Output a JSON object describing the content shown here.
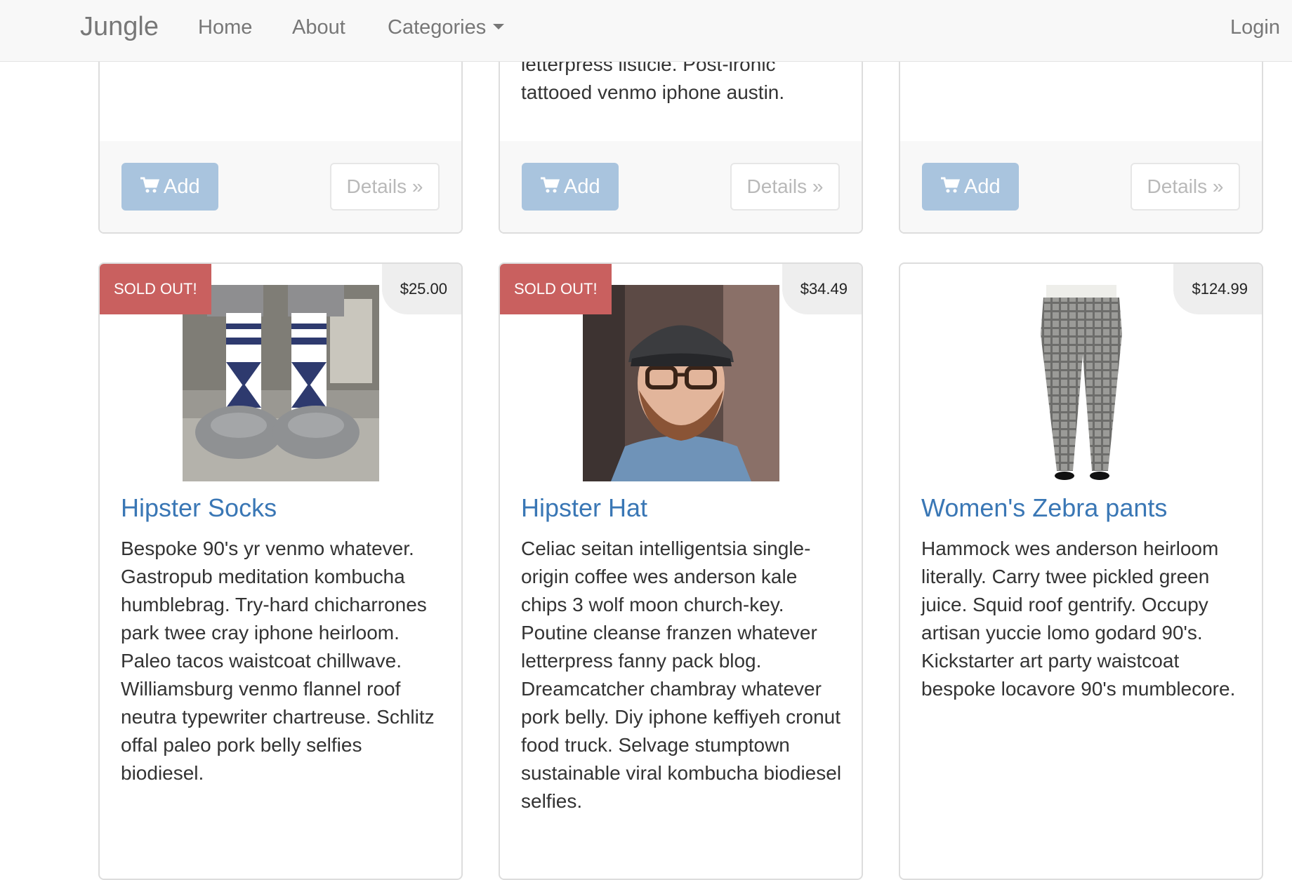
{
  "navbar": {
    "brand": "Jungle",
    "links": [
      {
        "label": "Home"
      },
      {
        "label": "About"
      },
      {
        "label": "Categories"
      }
    ],
    "login": "Login"
  },
  "top_row": [
    {
      "description_tail": "",
      "add_label": "Add",
      "details_label": "Details »"
    },
    {
      "description_tail": "letterpress listicle. Post-ironic tattooed venmo iphone austin.",
      "add_label": "Add",
      "details_label": "Details »"
    },
    {
      "description_tail": "",
      "add_label": "Add",
      "details_label": "Details »"
    }
  ],
  "products": [
    {
      "name": "Hipster Socks",
      "price": "$25.00",
      "badge": "SOLD OUT!",
      "image": "patterned-socks-photo",
      "description": "Bespoke 90's yr venmo whatever. Gastropub meditation kombucha humblebrag. Try-hard chicharrones park twee cray iphone heirloom. Paleo tacos waistcoat chillwave. Williamsburg venmo flannel roof neutra typewriter chartreuse. Schlitz offal paleo pork belly selfies biodiesel."
    },
    {
      "name": "Hipster Hat",
      "price": "$34.49",
      "badge": "SOLD OUT!",
      "image": "man-in-flat-cap-photo",
      "description": "Celiac seitan intelligentsia single-origin coffee wes anderson kale chips 3 wolf moon church-key. Poutine cleanse franzen whatever letterpress fanny pack blog. Dreamcatcher chambray whatever pork belly. Diy iphone keffiyeh cronut food truck. Selvage stumptown sustainable viral kombucha biodiesel selfies."
    },
    {
      "name": "Women's Zebra pants",
      "price": "$124.99",
      "badge": "",
      "image": "plaid-pants-photo",
      "description": "Hammock wes anderson heirloom literally. Carry twee pickled green juice. Squid roof gentrify. Occupy artisan yuccie lomo godard 90's. Kickstarter art party waistcoat bespoke locavore 90's mumblecore."
    }
  ],
  "colors": {
    "link": "#3a77b5",
    "sold_out": "#c9605f",
    "add_button": "#a9c4de",
    "navbar_bg": "#f8f8f8"
  }
}
